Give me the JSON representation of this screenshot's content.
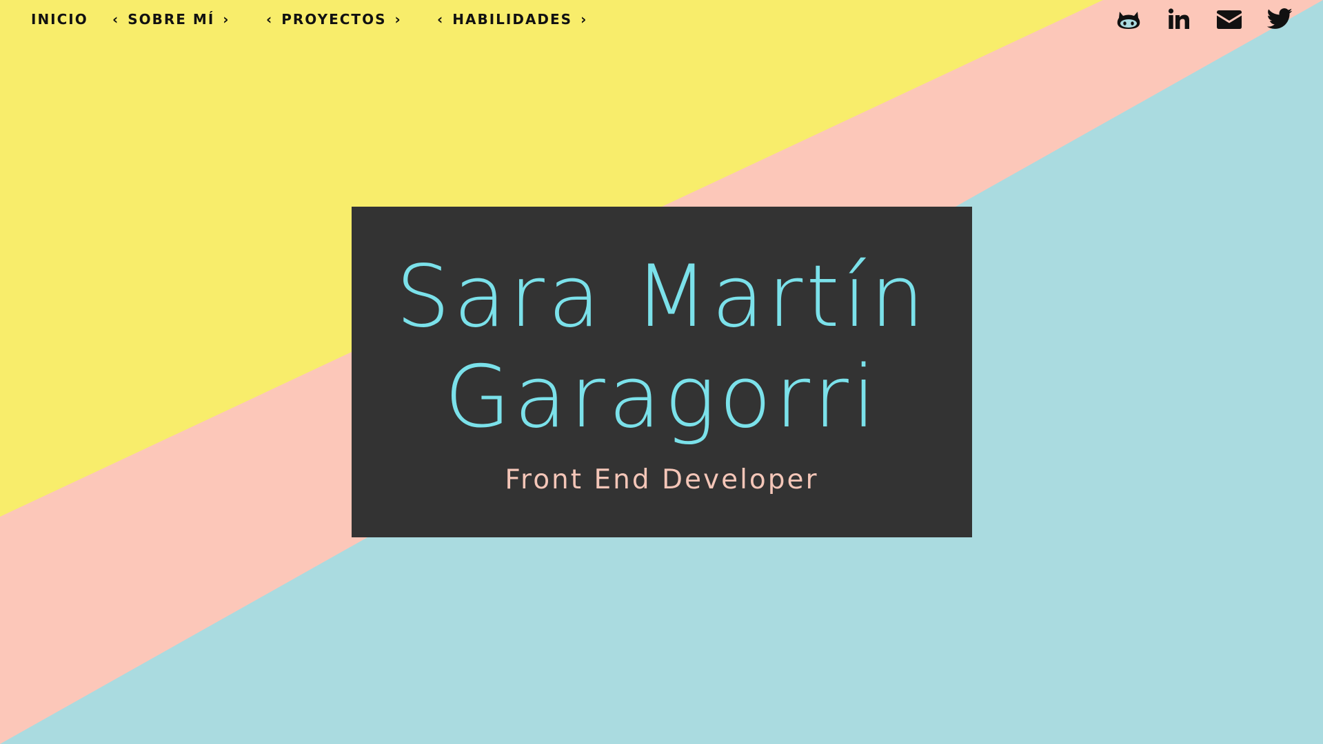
{
  "colors": {
    "yellow": "#f8ed6b",
    "blue": "#aadbe0",
    "peach": "#fcc7b9",
    "card": "#333333",
    "name": "#7be1ea",
    "role": "#f4c6b8",
    "nav_text": "#111111"
  },
  "nav": {
    "items": [
      {
        "label": "INICIO",
        "chevrons": false
      },
      {
        "label": "SOBRE MÍ",
        "chevrons": true,
        "chevron_left": "‹",
        "chevron_right": "›"
      },
      {
        "label": "PROYECTOS",
        "chevrons": true,
        "chevron_left": "‹",
        "chevron_right": "›"
      },
      {
        "label": "HABILIDADES",
        "chevrons": true,
        "chevron_left": "‹",
        "chevron_right": "›"
      }
    ]
  },
  "social": [
    {
      "icon": "github-icon"
    },
    {
      "icon": "linkedin-icon"
    },
    {
      "icon": "email-icon"
    },
    {
      "icon": "twitter-icon"
    }
  ],
  "hero": {
    "name_line1": "Sara Martín",
    "name_line2": "Garagorri",
    "role": "Front End Developer"
  }
}
